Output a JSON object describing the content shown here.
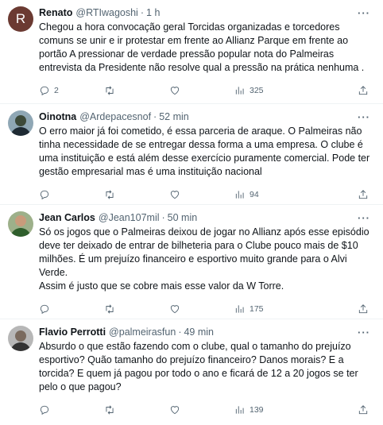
{
  "tweets": [
    {
      "avatar_letter": "R",
      "name": "Renato",
      "handle": "@RTIwagoshi",
      "time": "1 h",
      "lines": [
        "Chegou a hora convocação geral Torcidas organizadas e torcedores comuns se unir e ir protestar em frente ao Allianz Parque em frente ao portão A pressionar de verdade pressão popular nota do Palmeiras entrevista da Presidente não resolve qual a pressão na prática nenhuma ."
      ],
      "replies": "2",
      "retweets": "",
      "likes": "",
      "views": "325"
    },
    {
      "name": "Oinotna",
      "handle": "@Ardepacesnof",
      "time": "52 min",
      "lines": [
        "O erro maior já foi cometido, é essa parceria de araque. O Palmeiras não tinha necessidade de se entregar dessa forma a uma empresa. O clube é uma instituição e está além desse exercício puramente comercial. Pode ter gestão empresarial mas é uma instituição nacional"
      ],
      "replies": "",
      "retweets": "",
      "likes": "",
      "views": "94"
    },
    {
      "name": "Jean Carlos",
      "handle": "@Jean107mil",
      "time": "50 min",
      "lines": [
        "Só os jogos que o Palmeiras deixou de jogar no Allianz após esse episódio deve ter deixado de entrar de bilheteria para o Clube pouco mais de $10 milhões. É um prejuízo financeiro e esportivo muito grande para o Alvi Verde.",
        "Assim é justo que se cobre mais esse valor da W Torre."
      ],
      "replies": "",
      "retweets": "",
      "likes": "",
      "views": "175"
    },
    {
      "name": "Flavio Perrotti",
      "handle": "@palmeirasfun",
      "time": "49 min",
      "lines": [
        "Absurdo o que estão fazendo com o clube, qual o tamanho do prejuízo esportivo? Quão tamanho do prejuízo financeiro? Danos morais? E a torcida? E quem já pagou por todo o ano e ficará de 12 a 20 jogos se ter pelo o que pagou?"
      ],
      "replies": "",
      "retweets": "",
      "likes": "",
      "views": "139"
    }
  ],
  "icons": {
    "reply": "reply-icon",
    "retweet": "retweet-icon",
    "like": "heart-icon",
    "views": "views-icon",
    "share": "share-icon",
    "more": "more-icon"
  },
  "colors": {
    "text": "#0f1419",
    "secondary": "#536471",
    "divider": "#eff3f4"
  },
  "more_glyph": "···"
}
